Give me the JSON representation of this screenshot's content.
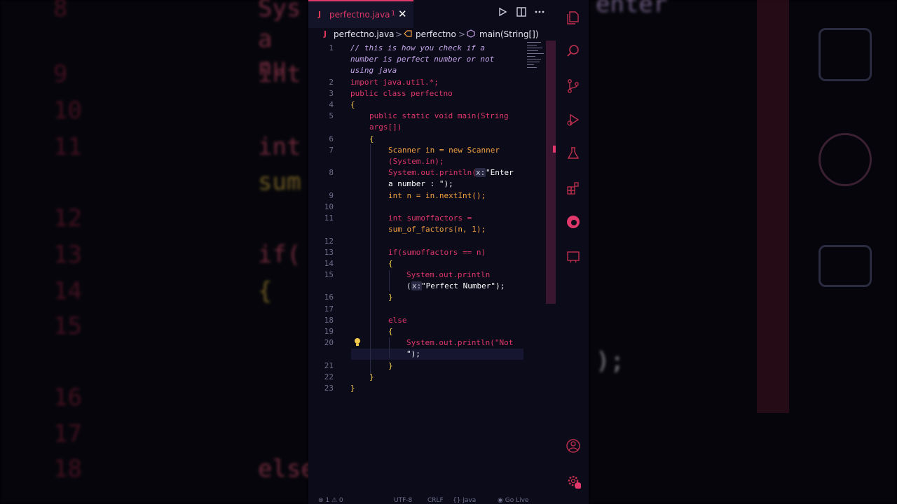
{
  "tab": {
    "icon_letter": "J",
    "filename": "perfectno.java",
    "badge": "1",
    "close_icon": "close-icon"
  },
  "toolbar": {
    "run_icon": "play-icon",
    "split_icon": "split-editor-icon",
    "more_icon": "more-icon"
  },
  "breadcrumb": {
    "file_icon_letter": "J",
    "file": "perfectno.java",
    "class_icon": "class-icon",
    "class": "perfectno",
    "method_icon": "method-icon",
    "method": "main(String[])",
    "separator": ">"
  },
  "editor": {
    "line_numbers": [
      "1",
      "2",
      "3",
      "4",
      "5",
      "6",
      "7",
      "8",
      "9",
      "10",
      "11",
      "12",
      "13",
      "14",
      "15",
      "16",
      "17",
      "18",
      "19",
      "20",
      "21",
      "22",
      "23"
    ],
    "lines": [
      "// this is how you check if a",
      "number is perfect number or not",
      "using java",
      "import java.util.*;",
      "public class perfectno",
      "{",
      "public static void main(String",
      "args[])",
      "{",
      "Scanner in = new Scanner",
      "(System.in);",
      "System.out.println(",
      "x:",
      "\"Enter",
      "a number : \");",
      "int n = in.nextInt();",
      "int sumoffactors =",
      "sum_of_factors(n, 1);",
      "if(sumoffactors == n)",
      "{",
      "System.out.println",
      "(",
      "x:",
      "\"Perfect Number\");",
      "}",
      "else",
      "{",
      "System.out.println(\"Not",
      "\");",
      "}",
      "}",
      "}"
    ]
  },
  "activity_bar": [
    "explorer-icon",
    "search-icon",
    "source-control-icon",
    "run-debug-icon",
    "testing-icon",
    "extensions-icon",
    "edge-browser-icon",
    "remote-explorer-icon",
    "account-icon",
    "settings-gear-icon"
  ],
  "statusbar": {
    "problems": "⊗ 1 ⚠ 0",
    "encoding": "UTF-8",
    "eol": "CRLF",
    "language": "{} Java",
    "live": "◉ Go Live"
  },
  "background": {
    "line_numbers": [
      "8",
      "9",
      "10",
      "11",
      "12",
      "13",
      "14",
      "15",
      "16",
      "17",
      "18"
    ],
    "fragments": [
      "Sys",
      "a nu",
      "int",
      "int",
      "sum",
      "if(",
      "{",
      "else",
      "enter",
      ");"
    ]
  },
  "colors": {
    "accent": "#e0386a",
    "background": "#0b0b1a",
    "keyword": "#e0386a",
    "type": "#f0a040",
    "comment": "#c5a5e8"
  }
}
